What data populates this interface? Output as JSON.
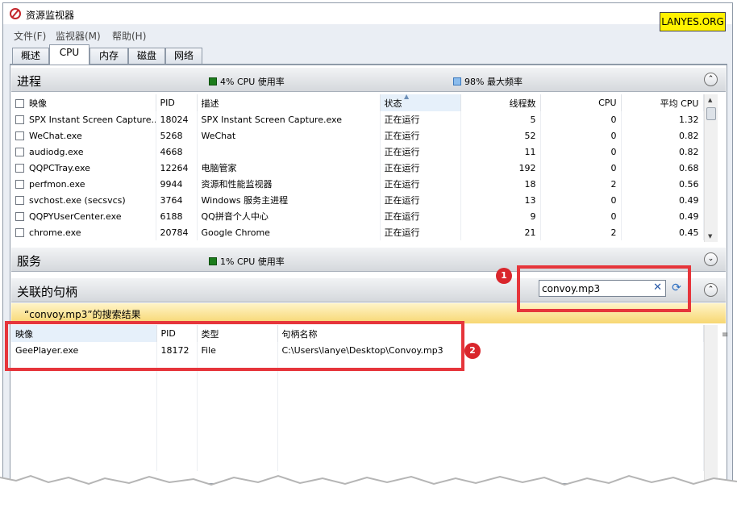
{
  "window": {
    "title": "资源监视器",
    "watermark": "LANYES.ORG"
  },
  "menu": [
    "文件(F)",
    "监视器(M)",
    "帮助(H)"
  ],
  "tabs": [
    "概述",
    "CPU",
    "内存",
    "磁盘",
    "网络"
  ],
  "active_tab": "CPU",
  "processes": {
    "title": "进程",
    "cpu_usage": "4% CPU 使用率",
    "max_freq": "98% 最大频率",
    "columns": [
      "映像",
      "PID",
      "描述",
      "状态",
      "线程数",
      "CPU",
      "平均 CPU"
    ],
    "rows": [
      [
        "SPX Instant Screen Capture....",
        "18024",
        "SPX Instant Screen Capture.exe",
        "正在运行",
        "5",
        "0",
        "1.32"
      ],
      [
        "WeChat.exe",
        "5268",
        "WeChat",
        "正在运行",
        "52",
        "0",
        "0.82"
      ],
      [
        "audiodg.exe",
        "4668",
        "",
        "正在运行",
        "11",
        "0",
        "0.82"
      ],
      [
        "QQPCTray.exe",
        "12264",
        "电脑管家",
        "正在运行",
        "192",
        "0",
        "0.68"
      ],
      [
        "perfmon.exe",
        "9944",
        "资源和性能监视器",
        "正在运行",
        "18",
        "2",
        "0.56"
      ],
      [
        "svchost.exe (secsvcs)",
        "3764",
        "Windows 服务主进程",
        "正在运行",
        "13",
        "0",
        "0.49"
      ],
      [
        "QQPYUserCenter.exe",
        "6188",
        "QQ拼音个人中心",
        "正在运行",
        "9",
        "0",
        "0.49"
      ],
      [
        "chrome.exe",
        "20784",
        "Google Chrome",
        "正在运行",
        "21",
        "2",
        "0.45"
      ]
    ]
  },
  "services": {
    "title": "服务",
    "cpu_usage": "1% CPU 使用率"
  },
  "handles": {
    "title": "关联的句柄",
    "search_value": "convoy.mp3",
    "results_label": "“convoy.mp3”的搜索结果",
    "columns": [
      "映像",
      "PID",
      "类型",
      "句柄名称"
    ],
    "rows": [
      [
        "GeePlayer.exe",
        "18172",
        "File",
        "C:\\Users\\lanye\\Desktop\\Convoy.mp3"
      ]
    ]
  },
  "annotations": [
    "1",
    "2"
  ],
  "colors": {
    "highlight_red": "#e6353b",
    "results_yellow": "#f7d772",
    "watermark_yellow": "#fff200"
  }
}
